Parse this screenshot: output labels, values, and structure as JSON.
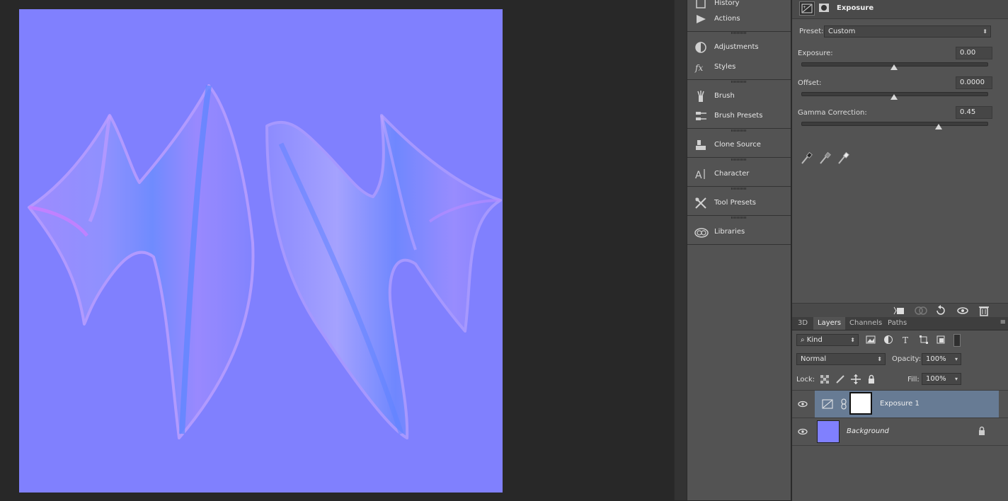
{
  "dock": {
    "groups": [
      {
        "items": [
          {
            "label": "History",
            "icon": "history-icon"
          },
          {
            "label": "Actions",
            "icon": "actions-play-icon"
          }
        ]
      },
      {
        "items": [
          {
            "label": "Adjustments",
            "icon": "adjustments-icon"
          },
          {
            "label": "Styles",
            "icon": "styles-fx-icon"
          }
        ]
      },
      {
        "items": [
          {
            "label": "Brush",
            "icon": "brush-icon"
          },
          {
            "label": "Brush Presets",
            "icon": "brush-presets-icon"
          }
        ]
      },
      {
        "items": [
          {
            "label": "Clone Source",
            "icon": "clone-source-icon"
          }
        ]
      },
      {
        "items": [
          {
            "label": "Character",
            "icon": "character-icon"
          }
        ]
      },
      {
        "items": [
          {
            "label": "Tool Presets",
            "icon": "tool-presets-icon"
          }
        ]
      },
      {
        "items": [
          {
            "label": "Libraries",
            "icon": "libraries-icon"
          }
        ]
      }
    ]
  },
  "properties": {
    "title": "Exposure",
    "preset_label": "Preset:",
    "preset_value": "Custom",
    "exposure": {
      "label": "Exposure:",
      "value": "0.00",
      "position": 0.5
    },
    "offset": {
      "label": "Offset:",
      "value": "0.0000",
      "position": 0.5
    },
    "gamma": {
      "label": "Gamma Correction:",
      "value": "0.45",
      "position": 0.74
    }
  },
  "layers": {
    "tabs": [
      "3D",
      "Layers",
      "Channels",
      "Paths"
    ],
    "active_tab": "Layers",
    "filter_kind": "Kind",
    "blend_mode": "Normal",
    "opacity_label": "Opacity:",
    "opacity_value": "100%",
    "lock_label": "Lock:",
    "fill_label": "Fill:",
    "fill_value": "100%",
    "items": [
      {
        "name": "Exposure 1",
        "selected": true
      },
      {
        "name": "Background",
        "locked": true
      }
    ]
  },
  "colors": {
    "canvas_normal_map": "#8080fe",
    "selected_layer": "#677b94"
  }
}
